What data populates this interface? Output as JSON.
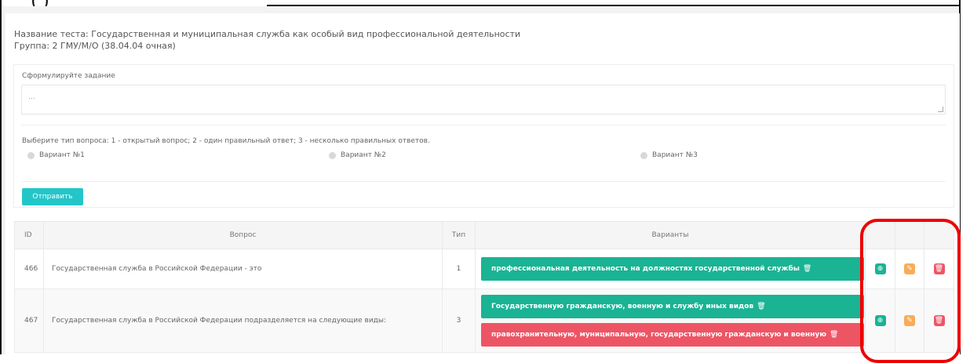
{
  "overlay_caption": "(                                      )",
  "test": {
    "title": "Название теста: Государственная и муниципальная служба как особый вид профессиональной деятельности",
    "group": "Группа: 2 ГМУ/М/О (38.04.04 очная)"
  },
  "form": {
    "task_label": "Сформулируйте задание",
    "task_value": "...",
    "type_label": "Выберите тип вопроса: 1 - открытый вопрос; 2 - один правильный ответ; 3 - несколько правильных ответов.",
    "type_options": [
      "Вариант №1",
      "Вариант №2",
      "Вариант №3"
    ],
    "submit_label": "Отправить"
  },
  "table": {
    "headers": {
      "id": "ID",
      "question": "Вопрос",
      "type": "Тип",
      "variants": "Варианты",
      "a1": "",
      "a2": "",
      "a3": ""
    },
    "rows": [
      {
        "id": "466",
        "question": "Государственная служба в Российской Федерации - это",
        "type": "1",
        "variants": [
          {
            "text": "профессиональная деятельность на должностях государственной службы",
            "correct": true
          }
        ]
      },
      {
        "id": "467",
        "question": "Государственная служба в Российской Федерации подразделяется на следующие виды:",
        "type": "3",
        "variants": [
          {
            "text": "Государственную гражданскую, военную и службу иных видов",
            "correct": true
          },
          {
            "text": "правохранительную, муниципальную, государственную гражданскую и военную",
            "correct": false
          }
        ]
      }
    ]
  },
  "colors": {
    "correct": "#1ab394",
    "wrong": "#ed5565",
    "edit": "#f8ac59",
    "submit": "#23c6c8",
    "highlight": "#ee0000"
  },
  "icons": {
    "add": "⊕",
    "edit": "✎",
    "delete": "🗑",
    "variant_delete": "🗑"
  }
}
